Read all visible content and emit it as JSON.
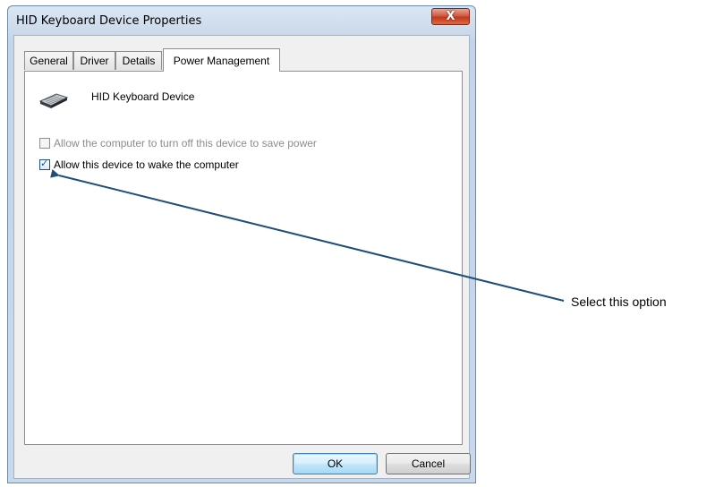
{
  "window": {
    "title": "HID Keyboard Device Properties",
    "close_glyph": "X"
  },
  "tabs": [
    {
      "label": "General",
      "active": false
    },
    {
      "label": "Driver",
      "active": false
    },
    {
      "label": "Details",
      "active": false
    },
    {
      "label": "Power Management",
      "active": true
    }
  ],
  "panel": {
    "device_icon": "keyboard-icon",
    "device_name": "HID Keyboard Device",
    "options": [
      {
        "label": "Allow the computer to turn off this device to save power",
        "checked": false,
        "enabled": false
      },
      {
        "label": "Allow this device to wake the computer",
        "checked": true,
        "enabled": true
      }
    ]
  },
  "buttons": {
    "ok_label": "OK",
    "cancel_label": "Cancel"
  },
  "annotation": {
    "text": "Select this option",
    "color": "#1f4e79"
  },
  "colors": {
    "checkmark": "#1d4aa8",
    "close_button": "#c2391d"
  }
}
